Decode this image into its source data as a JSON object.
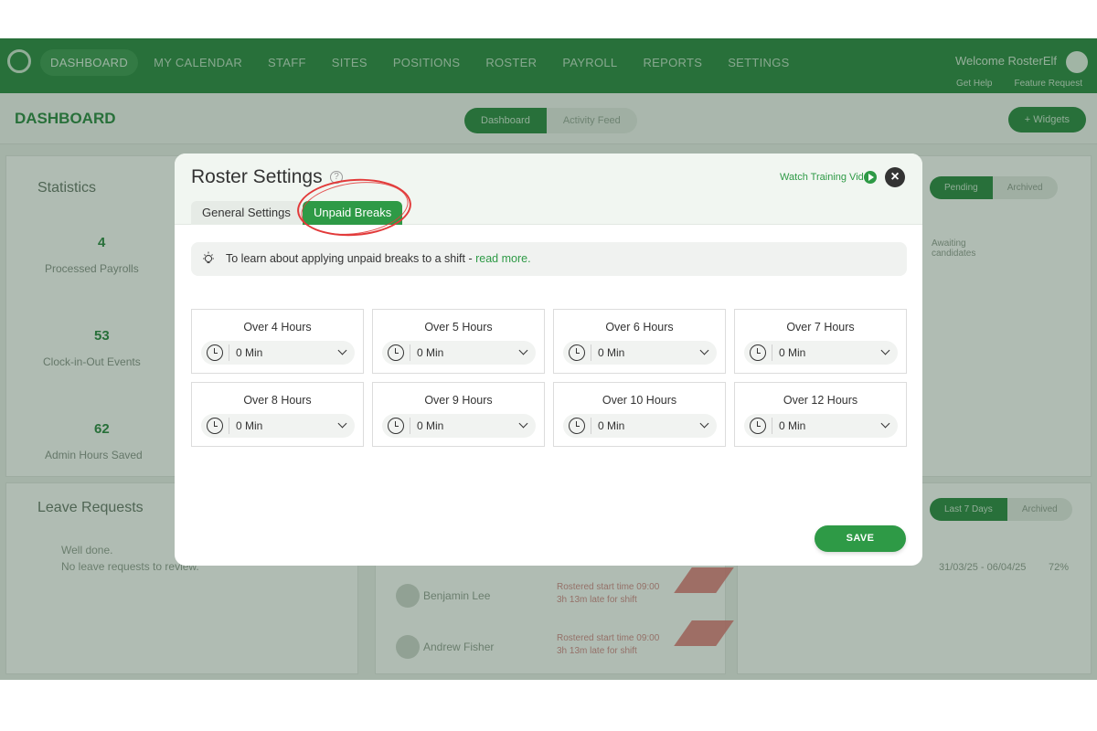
{
  "colors": {
    "brand": "#2f8a45",
    "accent": "#2e9a46",
    "annotation": "#e23a3a"
  },
  "nav": {
    "items": [
      "DASHBOARD",
      "MY CALENDAR",
      "STAFF",
      "SITES",
      "POSITIONS",
      "ROSTER",
      "PAYROLL",
      "REPORTS",
      "SETTINGS"
    ],
    "active": "DASHBOARD",
    "welcome": "Welcome RosterElf",
    "get_help": "Get Help",
    "feature_request": "Feature Request"
  },
  "dashboard": {
    "title": "DASHBOARD",
    "tab_dashboard": "Dashboard",
    "tab_activity": "Activity Feed",
    "widgets_button": "+ Widgets"
  },
  "statistics": {
    "title": "Statistics",
    "items": [
      {
        "value": "4",
        "label": "Processed Payrolls"
      },
      {
        "value": "53",
        "label": "Clock-in-Out Events"
      },
      {
        "value": "62",
        "label": "Admin Hours Saved"
      }
    ]
  },
  "right_panel": {
    "pending": "Pending",
    "archived": "Archived",
    "awaiting": "Awaiting candidates",
    "last7": "Last 7 Days",
    "archived2": "Archived",
    "date_range": "31/03/25 - 06/04/25",
    "percent": "72%"
  },
  "leave": {
    "title": "Leave Requests",
    "well_done": "Well done.",
    "message": "No leave requests to review."
  },
  "late": [
    {
      "name": "Benjamin Lee",
      "line1": "Rostered start time 09:00",
      "line2": "3h 13m late for shift"
    },
    {
      "name": "Andrew Fisher",
      "line1": "Rostered start time 09:00",
      "line2": "3h 13m late for shift"
    }
  ],
  "modal": {
    "title": "Roster Settings",
    "help_mark": "?",
    "watch_video": "Watch Training Video",
    "close_symbol": "×",
    "tab_general": "General Settings",
    "tab_unpaid": "Unpaid Breaks",
    "info_text": "To learn about applying unpaid breaks to a shift - ",
    "info_link": "read more.",
    "save": "SAVE",
    "breaks": [
      {
        "label": "Over 4 Hours",
        "value": "0 Min"
      },
      {
        "label": "Over 5 Hours",
        "value": "0 Min"
      },
      {
        "label": "Over 6 Hours",
        "value": "0 Min"
      },
      {
        "label": "Over 7 Hours",
        "value": "0 Min"
      },
      {
        "label": "Over 8 Hours",
        "value": "0 Min"
      },
      {
        "label": "Over 9 Hours",
        "value": "0 Min"
      },
      {
        "label": "Over 10 Hours",
        "value": "0 Min"
      },
      {
        "label": "Over 12 Hours",
        "value": "0 Min"
      }
    ]
  }
}
